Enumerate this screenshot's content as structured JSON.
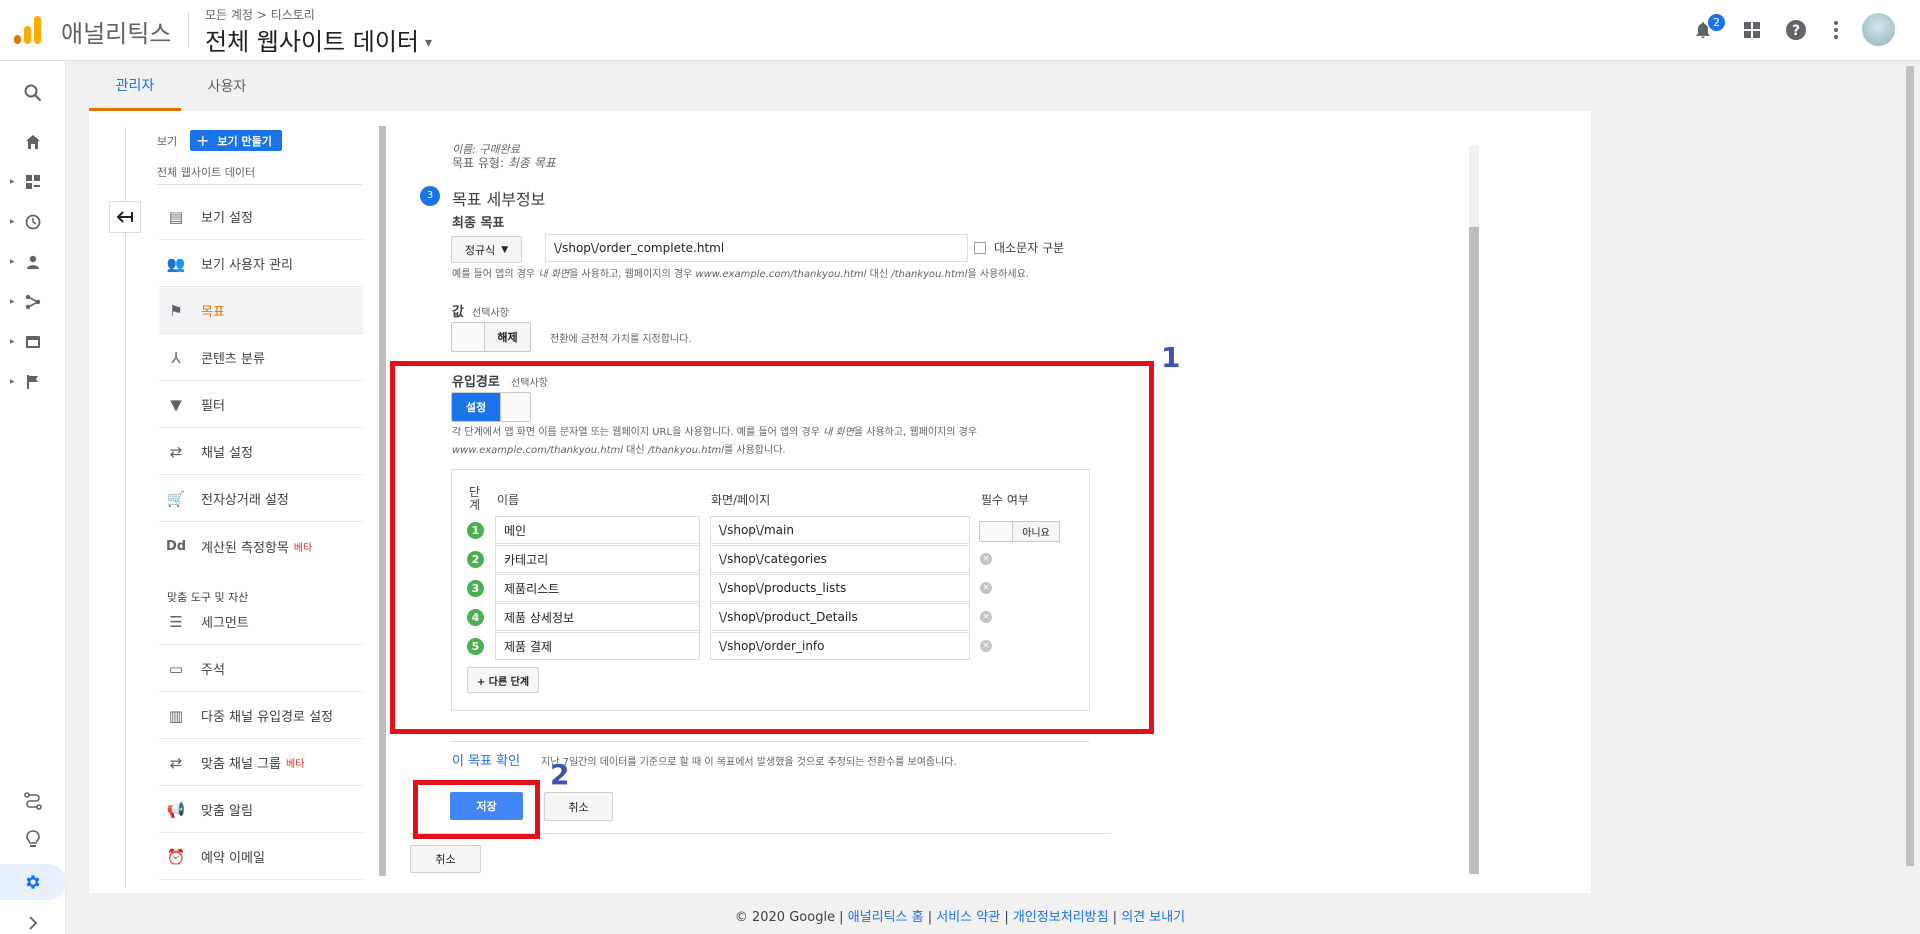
{
  "header": {
    "app_name": "애널리틱스",
    "breadcrumb": "모든 계정 > 티스토리",
    "property_title": "전체 웹사이트 데이터",
    "notification_count": "2",
    "colors": {
      "brand_orange": "#f9ab00",
      "brand_dark_orange": "#e37400",
      "accent": "#1a73e8"
    }
  },
  "tabs": [
    {
      "label": "관리자"
    },
    {
      "label": "사용자"
    }
  ],
  "nav": {
    "view_label": "보기",
    "create_view": "보기 만들기",
    "view_name": "전체 웹사이트 데이터",
    "items": [
      {
        "label": "보기 설정",
        "icon": "document-icon"
      },
      {
        "label": "보기 사용자 관리",
        "icon": "people-icon"
      },
      {
        "label": "목표",
        "icon": "flag-icon"
      },
      {
        "label": "콘텐츠 분류",
        "icon": "grouping-icon"
      },
      {
        "label": "필터",
        "icon": "filter-icon"
      },
      {
        "label": "채널 설정",
        "icon": "channel-icon"
      },
      {
        "label": "전자상거래 설정",
        "icon": "cart-icon"
      },
      {
        "label": "계산된 측정항목",
        "icon": "dd-icon",
        "badge": "베타"
      }
    ],
    "tools_header": "맞춤 도구 및 자산",
    "tools": [
      {
        "label": "세그먼트",
        "icon": "segment-icon"
      },
      {
        "label": "주석",
        "icon": "comment-icon"
      },
      {
        "label": "다중 채널 유입경로 설정",
        "icon": "bar-chart-icon"
      },
      {
        "label": "맞춤 채널 그룹",
        "icon": "channel-group-icon",
        "badge": "베타"
      },
      {
        "label": "맞춤 알림",
        "icon": "megaphone-icon"
      },
      {
        "label": "예약 이메일",
        "icon": "alarm-icon"
      }
    ]
  },
  "goal": {
    "name_line": "이름: 구매완료",
    "type_line_label": "목표 유형: ",
    "type_line_value": "최종 목표",
    "step_number": "3",
    "section_title": "목표 세부정보",
    "destination_label": "최종 목표",
    "match_type": "정규식",
    "destination_value": "\\/shop\\/order_complete.html",
    "case_sensitive": "대소문자 구분",
    "help_1": "예를 들어 앱의 경우 ",
    "help_1_em": "내 화면",
    "help_1b": "을 사용하고, 웹페이지의 경우 ",
    "help_1_url": "www.example.com/thankyou.html",
    "help_1c": " 대신 ",
    "help_1_path": "/thankyou.html",
    "help_1d": "을 사용하세요.",
    "value_label": "값",
    "optional": "선택사항",
    "value_toggle": "해제",
    "value_desc": "전환에 금전적 가치를 지정합니다."
  },
  "funnel": {
    "label": "유입경로",
    "optional": "선택사항",
    "toggle": "설정",
    "help_a": "각 단계에서 앱 화면 이름 문자열 또는 웹페이지 URL을 사용합니다. 예를 들어 앱의 경우 ",
    "help_em": "내 화면",
    "help_b": "을 사용하고, 웹페이지의 경우",
    "help_url": "www.example.com/thankyou.html",
    "help_c": " 대신 ",
    "help_path": "/thankyou.html",
    "help_d": "를 사용합니다.",
    "col_step": "단계",
    "col_name": "이름",
    "col_page": "화면/페이지",
    "col_required": "필수 여부",
    "required_toggle": "아니요",
    "steps": [
      {
        "num": "1",
        "name": "메인",
        "page": "\\/shop\\/main"
      },
      {
        "num": "2",
        "name": "카테고리",
        "page": "\\/shop\\/categories"
      },
      {
        "num": "3",
        "name": "제품리스트",
        "page": "\\/shop\\/products_lists"
      },
      {
        "num": "4",
        "name": "제품 상세정보",
        "page": "\\/shop\\/product_Details"
      },
      {
        "num": "5",
        "name": "제품 결제",
        "page": "\\/shop\\/order_info"
      }
    ],
    "add_step": "+ 다른 단계"
  },
  "verify": {
    "link": "이 목표 확인",
    "desc": "지난 7일간의 데이터를 기준으로 할 때 이 목표에서 발생했을 것으로 추정되는 전환수를 보여줍니다."
  },
  "actions": {
    "save": "저장",
    "cancel": "취소",
    "outer_cancel": "취소"
  },
  "annotations": {
    "one": "1",
    "two": "2",
    "color": "#e3101c"
  },
  "footer": {
    "copyright": "© 2020 Google | ",
    "links": [
      "애널리틱스 홈",
      "서비스 약관",
      "개인정보처리방침",
      "의견 보내기"
    ],
    "sep": " | "
  }
}
